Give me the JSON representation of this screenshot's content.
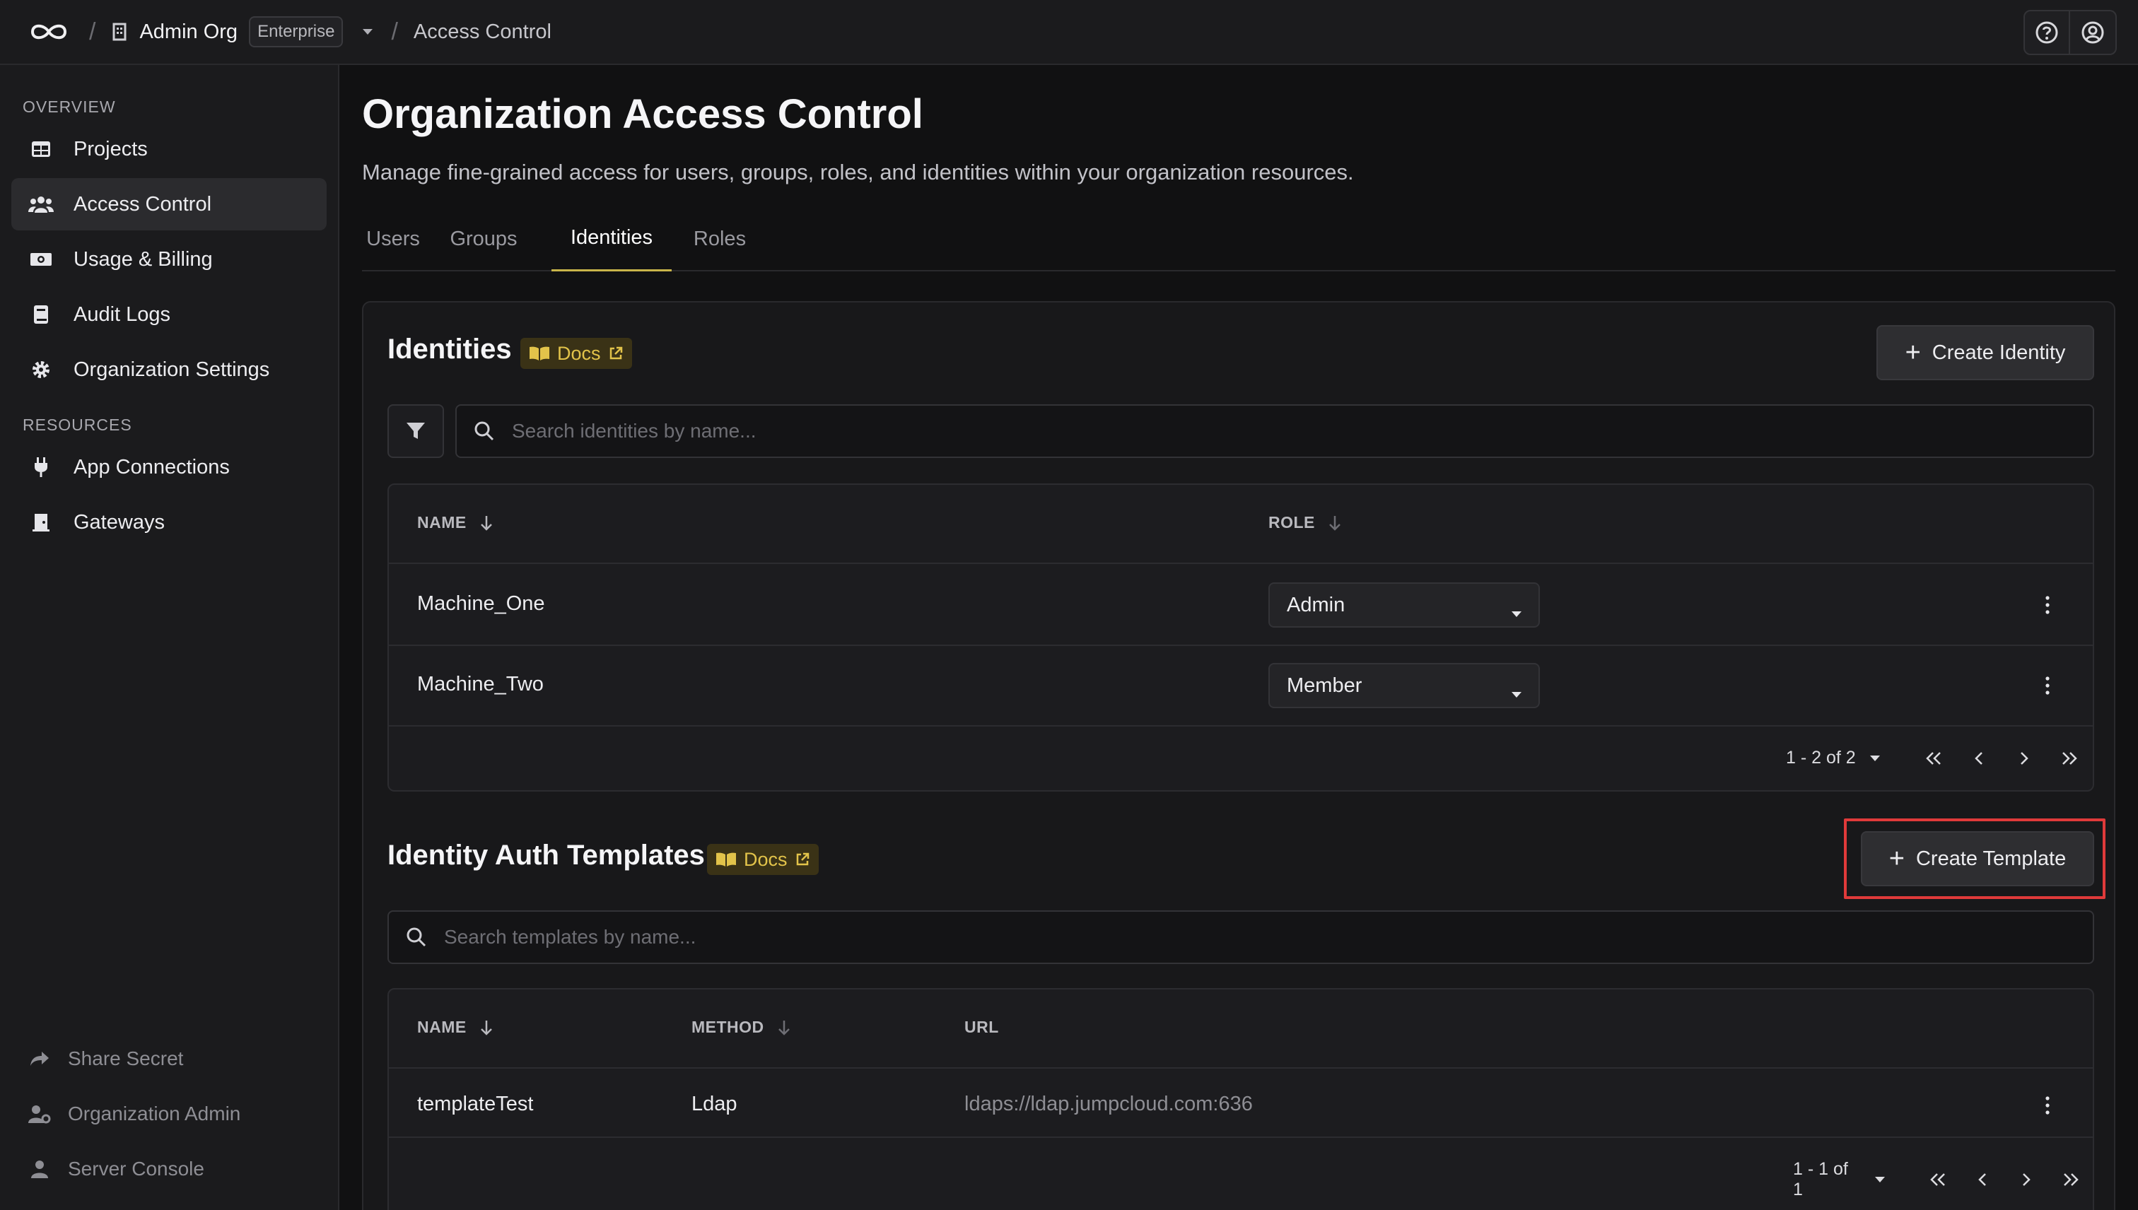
{
  "topbar": {
    "org_name": "Admin Org",
    "plan_badge": "Enterprise",
    "separator": "/",
    "current_page": "Access Control"
  },
  "sidebar": {
    "overview_label": "OVERVIEW",
    "resources_label": "RESOURCES",
    "items": [
      {
        "label": "Projects",
        "icon": "grid-icon"
      },
      {
        "label": "Access Control",
        "icon": "users-icon",
        "active": true
      },
      {
        "label": "Usage & Billing",
        "icon": "money-icon"
      },
      {
        "label": "Audit Logs",
        "icon": "book-icon"
      },
      {
        "label": "Organization Settings",
        "icon": "gear-icon"
      }
    ],
    "resources": [
      {
        "label": "App Connections",
        "icon": "plug-icon"
      },
      {
        "label": "Gateways",
        "icon": "gateway-icon"
      }
    ],
    "footer": [
      {
        "label": "Share Secret",
        "icon": "share-icon"
      },
      {
        "label": "Organization Admin",
        "icon": "user-cog-icon"
      },
      {
        "label": "Server Console",
        "icon": "user-icon"
      }
    ]
  },
  "main": {
    "title": "Organization Access Control",
    "description": "Manage fine-grained access for users, groups, roles, and identities within your organization resources.",
    "tabs": [
      "Users",
      "Groups",
      "Identities",
      "Roles"
    ],
    "active_tab": "Identities"
  },
  "identities": {
    "title": "Identities",
    "docs_label": "Docs",
    "create_button": "Create Identity",
    "search_placeholder": "Search identities by name...",
    "columns": [
      "NAME",
      "ROLE"
    ],
    "rows": [
      {
        "name": "Machine_One",
        "role": "Admin"
      },
      {
        "name": "Machine_Two",
        "role": "Member"
      }
    ],
    "pagination": "1 - 2 of 2"
  },
  "templates": {
    "title": "Identity Auth Templates",
    "docs_label": "Docs",
    "create_button": "Create Template",
    "search_placeholder": "Search templates by name...",
    "columns": [
      "NAME",
      "METHOD",
      "URL"
    ],
    "rows": [
      {
        "name": "templateTest",
        "method": "Ldap",
        "url": "ldaps://ldap.jumpcloud.com:636"
      }
    ],
    "pagination": "1 - 1 of 1"
  },
  "colors": {
    "accent": "#c9b54a",
    "docs_badge": "#e2c34a",
    "highlight": "#e03a3a",
    "background": "#111112"
  }
}
